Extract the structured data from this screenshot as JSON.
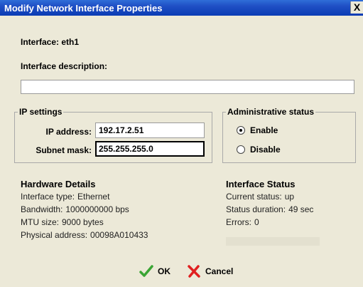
{
  "window": {
    "title": "Modify Network Interface Properties",
    "close_label": "X"
  },
  "interface": {
    "label": "Interface:",
    "value": "eth1"
  },
  "description": {
    "label": "Interface description:",
    "value": ""
  },
  "ip_settings": {
    "legend": "IP settings",
    "ip_label": "IP address:",
    "ip_value": "192.17.2.51",
    "mask_label": "Subnet mask:",
    "mask_value": "255.255.255.0"
  },
  "admin_status": {
    "legend": "Administrative status",
    "options": [
      {
        "label": "Enable",
        "selected": true
      },
      {
        "label": "Disable",
        "selected": false
      }
    ]
  },
  "hardware": {
    "title": "Hardware Details",
    "rows": [
      {
        "key": "Interface type:",
        "value": "Ethernet"
      },
      {
        "key": "Bandwidth:",
        "value": "1000000000 bps"
      },
      {
        "key": "MTU size:",
        "value": "9000 bytes"
      },
      {
        "key": "Physical address:",
        "value": "00098A010433"
      }
    ]
  },
  "status": {
    "title": "Interface Status",
    "rows": [
      {
        "key": "Current status:",
        "value": "up"
      },
      {
        "key": "Status duration:",
        "value": "49 sec"
      },
      {
        "key": "Errors:",
        "value": "0"
      }
    ]
  },
  "buttons": {
    "ok": "OK",
    "cancel": "Cancel"
  },
  "colors": {
    "ok_icon": "#3aa534",
    "cancel_icon": "#e02020",
    "title_bar": "#0a3cb4"
  }
}
